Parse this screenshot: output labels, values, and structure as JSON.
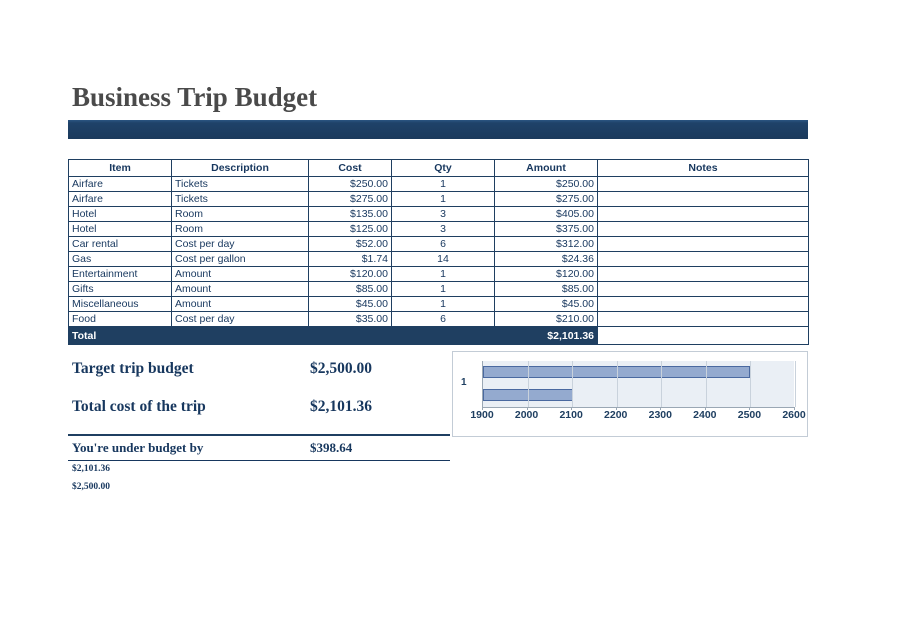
{
  "document": {
    "title": "Business Trip Budget"
  },
  "table": {
    "columns": [
      "Item",
      "Description",
      "Cost",
      "Qty",
      "Amount",
      "Notes"
    ],
    "rows": [
      {
        "item": "Airfare",
        "description": "Tickets",
        "cost": "$250.00",
        "qty": "1",
        "amount": "$250.00",
        "notes": ""
      },
      {
        "item": "Airfare",
        "description": "Tickets",
        "cost": "$275.00",
        "qty": "1",
        "amount": "$275.00",
        "notes": ""
      },
      {
        "item": "Hotel",
        "description": "Room",
        "cost": "$135.00",
        "qty": "3",
        "amount": "$405.00",
        "notes": ""
      },
      {
        "item": "Hotel",
        "description": "Room",
        "cost": "$125.00",
        "qty": "3",
        "amount": "$375.00",
        "notes": ""
      },
      {
        "item": "Car rental",
        "description": "Cost per day",
        "cost": "$52.00",
        "qty": "6",
        "amount": "$312.00",
        "notes": ""
      },
      {
        "item": "Gas",
        "description": "Cost per gallon",
        "cost": "$1.74",
        "qty": "14",
        "amount": "$24.36",
        "notes": ""
      },
      {
        "item": "Entertainment",
        "description": "Amount",
        "cost": "$120.00",
        "qty": "1",
        "amount": "$120.00",
        "notes": ""
      },
      {
        "item": "Gifts",
        "description": "Amount",
        "cost": "$85.00",
        "qty": "1",
        "amount": "$85.00",
        "notes": ""
      },
      {
        "item": "Miscellaneous",
        "description": "Amount",
        "cost": "$45.00",
        "qty": "1",
        "amount": "$45.00",
        "notes": ""
      },
      {
        "item": "Food",
        "description": "Cost per day",
        "cost": "$35.00",
        "qty": "6",
        "amount": "$210.00",
        "notes": ""
      }
    ],
    "total": {
      "label": "Total",
      "amount": "$2,101.36"
    }
  },
  "summary": {
    "rows": [
      {
        "label": "Target trip budget",
        "value": "$2,500.00"
      },
      {
        "label": "Total cost of the trip",
        "value": "$2,101.36"
      }
    ],
    "under_budget": {
      "label": "You're under budget by",
      "value": "$398.64"
    },
    "footer_values": [
      "$2,101.36",
      "$2,500.00"
    ]
  },
  "chart_data": {
    "type": "bar",
    "orientation": "horizontal",
    "title": "",
    "xlabel": "",
    "ylabel": "",
    "categories": [
      "1"
    ],
    "series": [
      {
        "name": "Target trip budget",
        "values": [
          2500.0
        ]
      },
      {
        "name": "Total cost of the trip",
        "values": [
          2101.36
        ]
      }
    ],
    "xlim": [
      1900,
      2600
    ],
    "xticks": [
      1900,
      2000,
      2100,
      2200,
      2300,
      2400,
      2500,
      2600
    ],
    "grid": true,
    "legend": "none",
    "bar_color": "#94aacf",
    "bar_border_color": "#4a69a0",
    "plot_background": "#eaeff5"
  },
  "theme": {
    "accent_navy": "#1f3f61",
    "text_navy": "#17375e",
    "title_gray": "#4a4a4a"
  }
}
